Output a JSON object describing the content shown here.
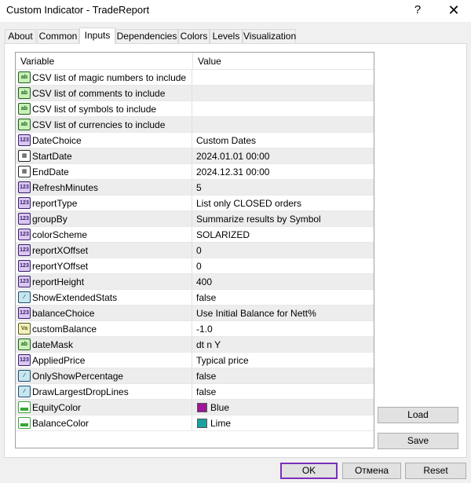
{
  "window": {
    "title": "Custom Indicator - TradeReport",
    "help_glyph": "?",
    "close_glyph": "✕"
  },
  "tabs": [
    "About",
    "Common",
    "Inputs",
    "Dependencies",
    "Colors",
    "Levels",
    "Visualization"
  ],
  "active_tab": "Inputs",
  "grid": {
    "col_variable": "Variable",
    "col_value": "Value",
    "rows": [
      {
        "icon": "ab",
        "name": "CSV list of magic numbers to include",
        "value": ""
      },
      {
        "icon": "ab",
        "name": "CSV list of comments to include",
        "value": ""
      },
      {
        "icon": "ab",
        "name": "CSV list of symbols to include",
        "value": ""
      },
      {
        "icon": "ab",
        "name": "CSV list of currencies to include",
        "value": ""
      },
      {
        "icon": "123",
        "name": "DateChoice",
        "value": "Custom Dates"
      },
      {
        "icon": "date",
        "name": "StartDate",
        "value": "2024.01.01 00:00"
      },
      {
        "icon": "date",
        "name": "EndDate",
        "value": "2024.12.31 00:00"
      },
      {
        "icon": "123",
        "name": "RefreshMinutes",
        "value": "5"
      },
      {
        "icon": "123",
        "name": "reportType",
        "value": "List only CLOSED orders"
      },
      {
        "icon": "123",
        "name": "groupBy",
        "value": "Summarize results by Symbol"
      },
      {
        "icon": "123",
        "name": "colorScheme",
        "value": "SOLARIZED"
      },
      {
        "icon": "123",
        "name": "reportXOffset",
        "value": "0"
      },
      {
        "icon": "123",
        "name": "reportYOffset",
        "value": "0"
      },
      {
        "icon": "123",
        "name": "reportHeight",
        "value": "400"
      },
      {
        "icon": "bool",
        "name": "ShowExtendedStats",
        "value": "false"
      },
      {
        "icon": "123",
        "name": "balanceChoice",
        "value": "Use Initial Balance for Nett%"
      },
      {
        "icon": "dbl",
        "name": "customBalance",
        "value": "-1.0"
      },
      {
        "icon": "ab",
        "name": "dateMask",
        "value": "dt n Y"
      },
      {
        "icon": "123",
        "name": "AppliedPrice",
        "value": "Typical price"
      },
      {
        "icon": "bool",
        "name": "OnlyShowPercentage",
        "value": "false"
      },
      {
        "icon": "bool",
        "name": "DrawLargestDropLines",
        "value": "false"
      },
      {
        "icon": "color",
        "name": "EquityColor",
        "value": "Blue",
        "swatch": "#a0149a"
      },
      {
        "icon": "color",
        "name": "BalanceColor",
        "value": "Lime",
        "swatch": "#1aa2a2"
      }
    ]
  },
  "buttons": {
    "load": "Load",
    "save": "Save",
    "ok": "OK",
    "cancel": "Отмена",
    "reset": "Reset"
  }
}
